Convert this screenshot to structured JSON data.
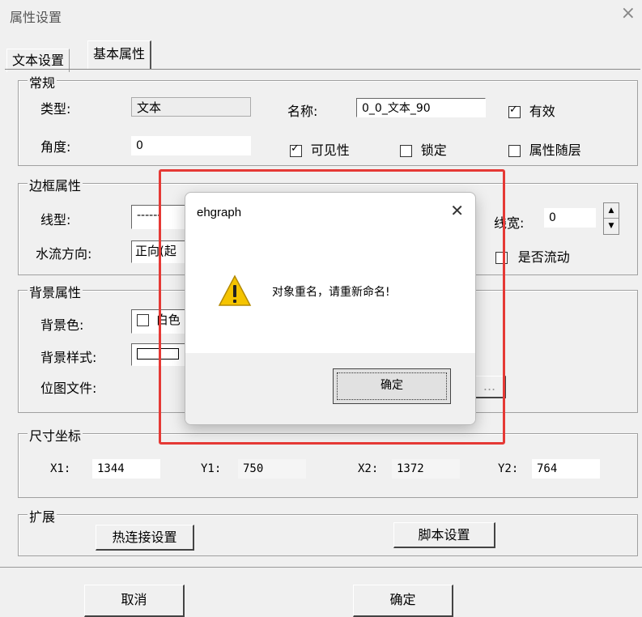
{
  "window": {
    "title": "属性设置",
    "close_glyph": "×"
  },
  "tabs": [
    {
      "label": "文本设置"
    },
    {
      "label": "基本属性"
    }
  ],
  "general": {
    "group_label": "常规",
    "type_label": "类型:",
    "type_value": "文本",
    "name_label": "名称:",
    "name_value": "0_0_文本_90",
    "valid_label": "有效",
    "valid_checked": true,
    "angle_label": "角度:",
    "angle_value": "0",
    "visible_label": "可见性",
    "visible_checked": true,
    "lock_label": "锁定",
    "lock_checked": false,
    "follow_layer_label": "属性随层",
    "follow_layer_checked": false
  },
  "border": {
    "group_label": "边框属性",
    "line_type_label": "线型:",
    "line_type_value": "------",
    "flow_dir_label": "水流方向:",
    "flow_dir_value": "正向(起",
    "line_width_label": "线宽:",
    "line_width_value": "0",
    "is_flow_label": "是否流动",
    "is_flow_checked": false
  },
  "background": {
    "group_label": "背景属性",
    "color_label": "背景色:",
    "color_value": "白色",
    "style_label": "背景样式:",
    "bitmap_label": "位图文件:",
    "browse_button": "..."
  },
  "size": {
    "group_label": "尺寸坐标",
    "x1_label": "X1:",
    "x1_value": "1344",
    "y1_label": "Y1:",
    "y1_value": "750",
    "x2_label": "X2:",
    "x2_value": "1372",
    "y2_label": "Y2:",
    "y2_value": "764"
  },
  "extend": {
    "group_label": "扩展",
    "hotlink_button": "热连接设置",
    "script_button": "脚本设置"
  },
  "footer": {
    "cancel_button": "取消",
    "ok_button": "确定"
  },
  "modal": {
    "title": "ehgraph",
    "close_glyph": "✕",
    "message": "对象重名，请重新命名!",
    "icon": "warning-icon",
    "ok_button": "确定"
  },
  "colors": {
    "highlight_box": "#e53935",
    "warning_yellow": "#f5c400"
  }
}
